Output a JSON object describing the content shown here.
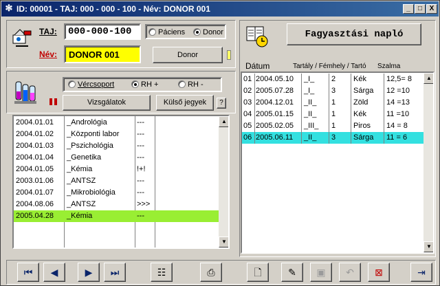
{
  "window": {
    "title": "ID: 00001  -  TAJ: 000 - 000 - 100  -  Név: DONOR 001",
    "min": "_",
    "max": "□",
    "close": "X"
  },
  "patient": {
    "taj_label": "TAJ:",
    "taj_value": "000-000-100",
    "name_label": "Név:",
    "name_value": "DONOR 001",
    "radio_paciens": "Páciens",
    "radio_donor": "Donor",
    "donor_button": "Donor"
  },
  "blood": {
    "radio_vercsoport": "Vércsoport",
    "radio_rh_plus": "RH +",
    "radio_rh_minus": "RH -",
    "vizsgalatok_button": "Vizsgálatok",
    "kulso_button": "Külső jegyek"
  },
  "exams": [
    {
      "date": "2004.01.01",
      "name": "_Andrológia",
      "flag": "---"
    },
    {
      "date": "2004.01.02",
      "name": "_Központi labor",
      "flag": "---"
    },
    {
      "date": "2004.01.03",
      "name": "_Pszichológia",
      "flag": "---"
    },
    {
      "date": "2004.01.04",
      "name": "_Genetika",
      "flag": "---"
    },
    {
      "date": "2004.01.05",
      "name": "_Kémia",
      "flag": "!+!"
    },
    {
      "date": "2003.01.06",
      "name": "_ANTSZ",
      "flag": "---"
    },
    {
      "date": "2004.01.07",
      "name": "_Mikrobiológia",
      "flag": "---"
    },
    {
      "date": "2004.08.06",
      "name": "_ANTSZ",
      "flag": ">>>"
    },
    {
      "date": "2005.04.28",
      "name": "_Kémia",
      "flag": "---"
    }
  ],
  "freeze": {
    "button": "Fagyasztási napló",
    "col_datum": "Dátum",
    "col_tartaly": "Tartály / Fémhely / Tartó",
    "col_szalma": "Szalma",
    "rows": [
      {
        "n": "01",
        "date": "2004.05.10",
        "tank": "_I_",
        "slot": "2",
        "color": "Kék",
        "straw": "12,5= 8"
      },
      {
        "n": "02",
        "date": "2005.07.28",
        "tank": "_I_",
        "slot": "3",
        "color": "Sárga",
        "straw": "12 =10"
      },
      {
        "n": "03",
        "date": "2004.12.01",
        "tank": "_II_",
        "slot": "1",
        "color": "Zöld",
        "straw": "14 =13"
      },
      {
        "n": "04",
        "date": "2005.01.15",
        "tank": "_II_",
        "slot": "1",
        "color": "Kék",
        "straw": "11 =10"
      },
      {
        "n": "05",
        "date": "2005.02.05",
        "tank": "_III_",
        "slot": "1",
        "color": "Piros",
        "straw": "14 = 8"
      },
      {
        "n": "06",
        "date": "2005.06.11",
        "tank": "_II_",
        "slot": "3",
        "color": "Sárga",
        "straw": "11 = 6"
      }
    ]
  },
  "colors": {
    "name_bg": "#ffff00",
    "exam_selected": "#99ee33",
    "freeze_selected": "#33e0e0"
  }
}
